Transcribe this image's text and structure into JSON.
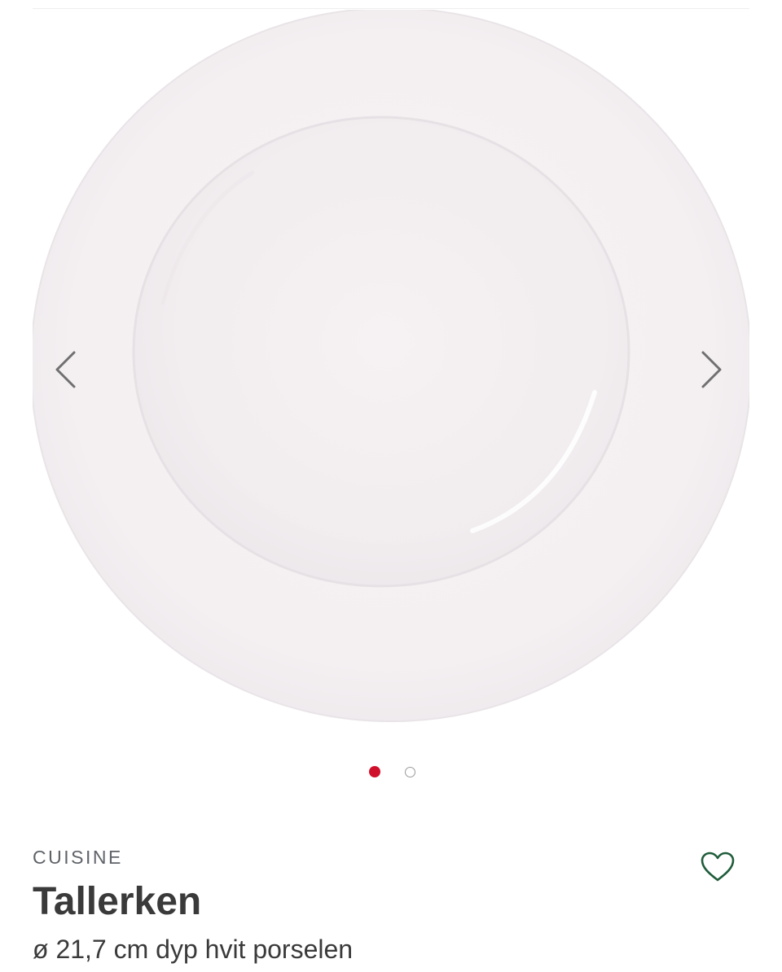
{
  "product": {
    "brand": "CUISINE",
    "title": "Tallerken",
    "subtitle": "ø 21,7 cm dyp hvit porselen"
  },
  "gallery": {
    "image_subject": "white deep porcelain plate",
    "prev_icon": "chevron-left-icon",
    "next_icon": "chevron-right-icon",
    "slide_count": 2,
    "active_slide": 1
  },
  "wishlist": {
    "icon": "heart-outline-icon"
  },
  "colors": {
    "active_dot": "#d0102b",
    "inactive_dot_border": "#9a9a9a",
    "heart": "#1f5c3a",
    "arrow": "#707070",
    "text_dark": "#3a3a3a",
    "text_muted": "#5f6368"
  }
}
